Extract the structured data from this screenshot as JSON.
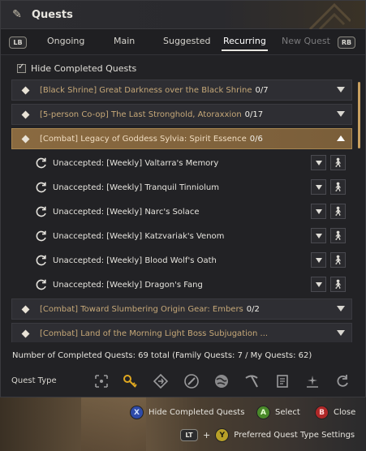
{
  "window": {
    "title": "Quests",
    "title_icon": "scroll-icon"
  },
  "tabs": {
    "left_bumper": "LB",
    "right_bumper": "RB",
    "items": [
      {
        "label": "Ongoing",
        "state": "normal"
      },
      {
        "label": "Main",
        "state": "normal"
      },
      {
        "label": "Suggested",
        "state": "normal"
      },
      {
        "label": "Recurring",
        "state": "active"
      },
      {
        "label": "New Quest",
        "state": "disabled"
      }
    ]
  },
  "filter": {
    "hide_completed_label": "Hide Completed Quests",
    "hide_completed_checked": true
  },
  "groups": [
    {
      "label": "[Black Shrine] Great Darkness over the Black Shrine",
      "count": "0/7",
      "expanded": false
    },
    {
      "label": "[5-person Co-op] The Last Stronghold, Atoraxxion",
      "count": "0/17",
      "expanded": false
    },
    {
      "label": "[Combat] Legacy of Goddess Sylvia: Spirit Essence",
      "count": "0/6",
      "expanded": true
    }
  ],
  "quests": [
    {
      "label": "Unaccepted: [Weekly] Valtarra's Memory"
    },
    {
      "label": "Unaccepted: [Weekly] Tranquil Tinniolum"
    },
    {
      "label": "Unaccepted: [Weekly] Narc's Solace"
    },
    {
      "label": "Unaccepted: [Weekly] Katzvariak's Venom"
    },
    {
      "label": "Unaccepted: [Weekly] Blood Wolf's Oath"
    },
    {
      "label": "Unaccepted: [Weekly] Dragon's Fang"
    }
  ],
  "groups_after": [
    {
      "label": "[Combat] Toward Slumbering Origin Gear: Embers",
      "count": "0/2",
      "expanded": false
    },
    {
      "label": "[Combat] Land of the Morning Light Boss Subjugation ...",
      "count": "",
      "expanded": false
    }
  ],
  "summary": {
    "completed_line": "Number of Completed Quests: 69 total (Family Quests: 7 / My Quests: 62)"
  },
  "quest_type": {
    "label": "Quest Type",
    "icons": [
      "target-icon",
      "key-icon",
      "diamond-arrow-icon",
      "compass-icon",
      "globe-icon",
      "pickaxe-icon",
      "book-icon",
      "sparkle-icon",
      "refresh-icon"
    ]
  },
  "controls": {
    "x_button": "X",
    "hide_completed": "Hide Completed Quests",
    "a_button": "A",
    "select": "Select",
    "b_button": "B",
    "close": "Close",
    "lt_button": "LT",
    "plus": "+",
    "y_button": "Y",
    "preferred_settings": "Preferred Quest Type Settings"
  },
  "colors": {
    "accent_gold": "#c9a060",
    "expanded_bg": "#8a6a40",
    "group_text": "#c6a878"
  }
}
